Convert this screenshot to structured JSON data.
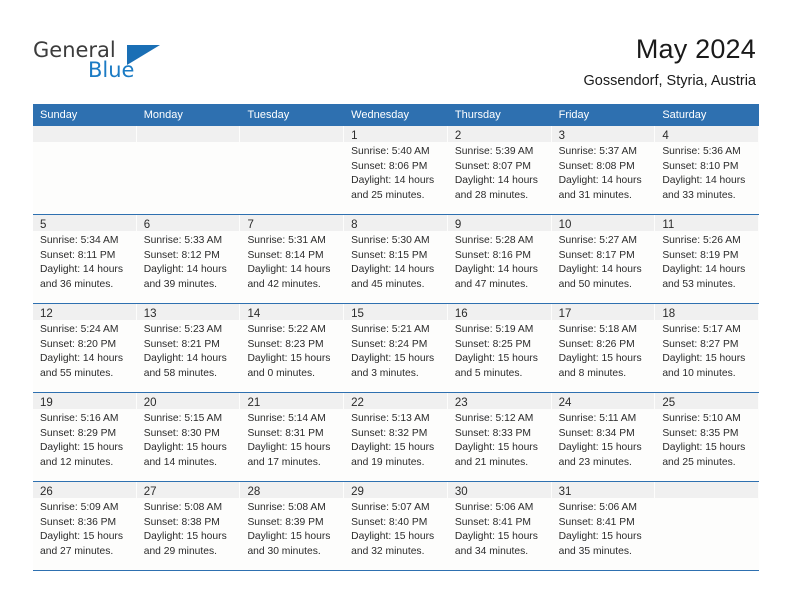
{
  "logo": {
    "word1": "General",
    "word2": "Blue",
    "mark": "triangle-mark"
  },
  "header": {
    "title": "May 2024",
    "location": "Gossendorf, Styria, Austria"
  },
  "colors": {
    "header_blue": "#2e70b0",
    "daynum_band": "#f0f0f0",
    "cell_bg": "#fdfdfc",
    "text": "#2b2b2b",
    "logo_blue": "#1b7bc4"
  },
  "weekdays": [
    "Sunday",
    "Monday",
    "Tuesday",
    "Wednesday",
    "Thursday",
    "Friday",
    "Saturday"
  ],
  "weeks": [
    [
      {
        "day": "",
        "lines": []
      },
      {
        "day": "",
        "lines": []
      },
      {
        "day": "",
        "lines": []
      },
      {
        "day": "1",
        "lines": [
          "Sunrise: 5:40 AM",
          "Sunset: 8:06 PM",
          "Daylight: 14 hours",
          "and 25 minutes."
        ]
      },
      {
        "day": "2",
        "lines": [
          "Sunrise: 5:39 AM",
          "Sunset: 8:07 PM",
          "Daylight: 14 hours",
          "and 28 minutes."
        ]
      },
      {
        "day": "3",
        "lines": [
          "Sunrise: 5:37 AM",
          "Sunset: 8:08 PM",
          "Daylight: 14 hours",
          "and 31 minutes."
        ]
      },
      {
        "day": "4",
        "lines": [
          "Sunrise: 5:36 AM",
          "Sunset: 8:10 PM",
          "Daylight: 14 hours",
          "and 33 minutes."
        ]
      }
    ],
    [
      {
        "day": "5",
        "lines": [
          "Sunrise: 5:34 AM",
          "Sunset: 8:11 PM",
          "Daylight: 14 hours",
          "and 36 minutes."
        ]
      },
      {
        "day": "6",
        "lines": [
          "Sunrise: 5:33 AM",
          "Sunset: 8:12 PM",
          "Daylight: 14 hours",
          "and 39 minutes."
        ]
      },
      {
        "day": "7",
        "lines": [
          "Sunrise: 5:31 AM",
          "Sunset: 8:14 PM",
          "Daylight: 14 hours",
          "and 42 minutes."
        ]
      },
      {
        "day": "8",
        "lines": [
          "Sunrise: 5:30 AM",
          "Sunset: 8:15 PM",
          "Daylight: 14 hours",
          "and 45 minutes."
        ]
      },
      {
        "day": "9",
        "lines": [
          "Sunrise: 5:28 AM",
          "Sunset: 8:16 PM",
          "Daylight: 14 hours",
          "and 47 minutes."
        ]
      },
      {
        "day": "10",
        "lines": [
          "Sunrise: 5:27 AM",
          "Sunset: 8:17 PM",
          "Daylight: 14 hours",
          "and 50 minutes."
        ]
      },
      {
        "day": "11",
        "lines": [
          "Sunrise: 5:26 AM",
          "Sunset: 8:19 PM",
          "Daylight: 14 hours",
          "and 53 minutes."
        ]
      }
    ],
    [
      {
        "day": "12",
        "lines": [
          "Sunrise: 5:24 AM",
          "Sunset: 8:20 PM",
          "Daylight: 14 hours",
          "and 55 minutes."
        ]
      },
      {
        "day": "13",
        "lines": [
          "Sunrise: 5:23 AM",
          "Sunset: 8:21 PM",
          "Daylight: 14 hours",
          "and 58 minutes."
        ]
      },
      {
        "day": "14",
        "lines": [
          "Sunrise: 5:22 AM",
          "Sunset: 8:23 PM",
          "Daylight: 15 hours",
          "and 0 minutes."
        ]
      },
      {
        "day": "15",
        "lines": [
          "Sunrise: 5:21 AM",
          "Sunset: 8:24 PM",
          "Daylight: 15 hours",
          "and 3 minutes."
        ]
      },
      {
        "day": "16",
        "lines": [
          "Sunrise: 5:19 AM",
          "Sunset: 8:25 PM",
          "Daylight: 15 hours",
          "and 5 minutes."
        ]
      },
      {
        "day": "17",
        "lines": [
          "Sunrise: 5:18 AM",
          "Sunset: 8:26 PM",
          "Daylight: 15 hours",
          "and 8 minutes."
        ]
      },
      {
        "day": "18",
        "lines": [
          "Sunrise: 5:17 AM",
          "Sunset: 8:27 PM",
          "Daylight: 15 hours",
          "and 10 minutes."
        ]
      }
    ],
    [
      {
        "day": "19",
        "lines": [
          "Sunrise: 5:16 AM",
          "Sunset: 8:29 PM",
          "Daylight: 15 hours",
          "and 12 minutes."
        ]
      },
      {
        "day": "20",
        "lines": [
          "Sunrise: 5:15 AM",
          "Sunset: 8:30 PM",
          "Daylight: 15 hours",
          "and 14 minutes."
        ]
      },
      {
        "day": "21",
        "lines": [
          "Sunrise: 5:14 AM",
          "Sunset: 8:31 PM",
          "Daylight: 15 hours",
          "and 17 minutes."
        ]
      },
      {
        "day": "22",
        "lines": [
          "Sunrise: 5:13 AM",
          "Sunset: 8:32 PM",
          "Daylight: 15 hours",
          "and 19 minutes."
        ]
      },
      {
        "day": "23",
        "lines": [
          "Sunrise: 5:12 AM",
          "Sunset: 8:33 PM",
          "Daylight: 15 hours",
          "and 21 minutes."
        ]
      },
      {
        "day": "24",
        "lines": [
          "Sunrise: 5:11 AM",
          "Sunset: 8:34 PM",
          "Daylight: 15 hours",
          "and 23 minutes."
        ]
      },
      {
        "day": "25",
        "lines": [
          "Sunrise: 5:10 AM",
          "Sunset: 8:35 PM",
          "Daylight: 15 hours",
          "and 25 minutes."
        ]
      }
    ],
    [
      {
        "day": "26",
        "lines": [
          "Sunrise: 5:09 AM",
          "Sunset: 8:36 PM",
          "Daylight: 15 hours",
          "and 27 minutes."
        ]
      },
      {
        "day": "27",
        "lines": [
          "Sunrise: 5:08 AM",
          "Sunset: 8:38 PM",
          "Daylight: 15 hours",
          "and 29 minutes."
        ]
      },
      {
        "day": "28",
        "lines": [
          "Sunrise: 5:08 AM",
          "Sunset: 8:39 PM",
          "Daylight: 15 hours",
          "and 30 minutes."
        ]
      },
      {
        "day": "29",
        "lines": [
          "Sunrise: 5:07 AM",
          "Sunset: 8:40 PM",
          "Daylight: 15 hours",
          "and 32 minutes."
        ]
      },
      {
        "day": "30",
        "lines": [
          "Sunrise: 5:06 AM",
          "Sunset: 8:41 PM",
          "Daylight: 15 hours",
          "and 34 minutes."
        ]
      },
      {
        "day": "31",
        "lines": [
          "Sunrise: 5:06 AM",
          "Sunset: 8:41 PM",
          "Daylight: 15 hours",
          "and 35 minutes."
        ]
      },
      {
        "day": "",
        "lines": []
      }
    ]
  ]
}
